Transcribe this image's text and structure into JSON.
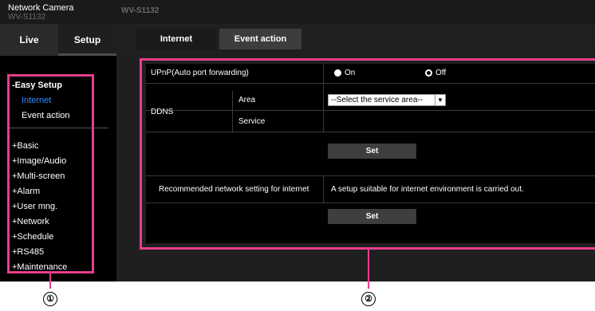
{
  "header": {
    "brand": "Network Camera",
    "model": "WV-S1132"
  },
  "main_tabs": [
    {
      "label": "Live"
    },
    {
      "label": "Setup"
    }
  ],
  "sidebar": {
    "easy_setup": "-Easy Setup",
    "sub_items": [
      {
        "label": "Internet"
      },
      {
        "label": "Event action"
      }
    ],
    "items": [
      {
        "label": "+Basic"
      },
      {
        "label": "+Image/Audio"
      },
      {
        "label": "+Multi-screen"
      },
      {
        "label": "+Alarm"
      },
      {
        "label": "+User mng."
      },
      {
        "label": "+Network"
      },
      {
        "label": "+Schedule"
      },
      {
        "label": "+RS485"
      },
      {
        "label": "+Maintenance"
      }
    ]
  },
  "content_tabs": [
    {
      "label": "Internet"
    },
    {
      "label": "Event action"
    }
  ],
  "settings": {
    "upnp_label": "UPnP(Auto port forwarding)",
    "upnp_on": "On",
    "upnp_off": "Off",
    "upnp_selected": "Off",
    "ddns_label": "DDNS",
    "area_label": "Area",
    "area_select": "--Select the service area--",
    "service_label": "Service",
    "set_button_1": "Set",
    "recommended_label": "Recommended network setting for internet",
    "recommended_desc": "A setup suitable for internet environment is carried out.",
    "set_button_2": "Set"
  },
  "callouts": {
    "one": "①",
    "two": "②"
  },
  "colors": {
    "highlight": "#e83e8c",
    "active_link": "#2f8cff"
  }
}
